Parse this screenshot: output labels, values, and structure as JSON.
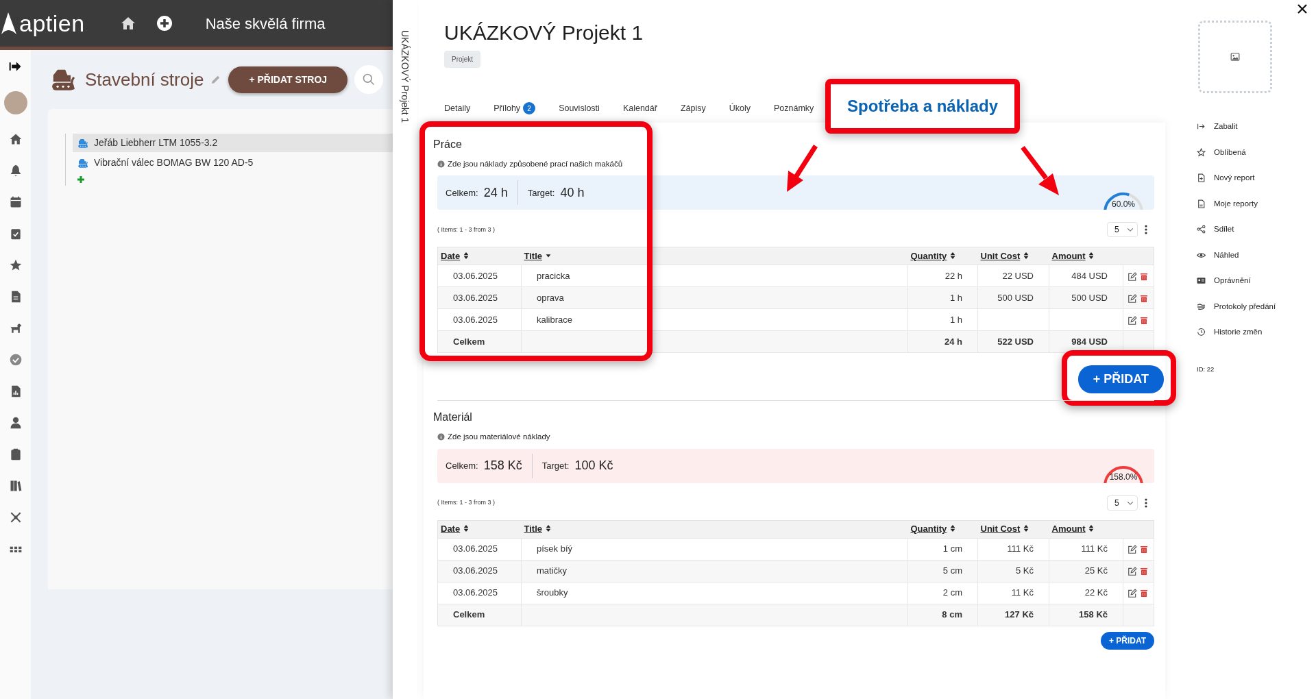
{
  "app": {
    "logo": "aptien",
    "company": "Naše skvělá firma"
  },
  "module": {
    "title": "Stavební stroje",
    "add_button": "+ PŘIDAT STROJ"
  },
  "tree": {
    "items": [
      {
        "label": "Jeřáb Liebherr LTM 1055-3.2",
        "selected": true
      },
      {
        "label": "Vibrační válec BOMAG BW 120 AD-5",
        "selected": false
      }
    ]
  },
  "drawer": {
    "side_title": "UKÁZKOVÝ Projekt 1",
    "title": "UKÁZKOVÝ Projekt 1",
    "badge": "Projekt",
    "tabs": [
      {
        "label": "Detaily",
        "selected": false
      },
      {
        "label": "Přílohy",
        "count": "2",
        "selected": false
      },
      {
        "label": "Souvislosti",
        "selected": false
      },
      {
        "label": "Kalendář",
        "selected": false
      },
      {
        "label": "Zápisy",
        "selected": false
      },
      {
        "label": "Úkoly",
        "selected": false
      },
      {
        "label": "Poznámky",
        "selected": false
      }
    ],
    "callout": "Spotřeba a náklady",
    "sections": [
      {
        "title": "Práce",
        "info": "Zde jsou náklady způsobené prací našich makáčů",
        "color": "#1f7fd6",
        "highlighted": true,
        "total_label": "Celkem:",
        "total": "24 h",
        "target_label": "Target:",
        "target": "40 h",
        "gauge": {
          "level": 0.6,
          "reading": "60.0%"
        },
        "items_info": "( Items: 1 - 3 from 3 )",
        "page_size": "5",
        "columns": [
          {
            "label": "Date",
            "sorted": false
          },
          {
            "label": "Title",
            "sorted": true
          },
          {
            "label": "Quantity",
            "sorted": false
          },
          {
            "label": "Unit Cost",
            "sorted": false
          },
          {
            "label": "Amount",
            "sorted": false
          }
        ],
        "rows": [
          {
            "date": "03.06.2025",
            "title": "pracicka",
            "quantity": "22 h",
            "unit_cost": "22 USD",
            "amount": "484 USD"
          },
          {
            "date": "03.06.2025",
            "title": "oprava",
            "quantity": "1 h",
            "unit_cost": "500 USD",
            "amount": "500 USD"
          },
          {
            "date": "03.06.2025",
            "title": "kalibrace",
            "quantity": "1 h"
          }
        ],
        "footer": {
          "label": "Celkem",
          "quantity": "24 h",
          "unit_cost": "522 USD",
          "amount": "984 USD"
        },
        "add_button": "+ PŘIDAT",
        "add_highlighted": true
      },
      {
        "title": "Materiál",
        "info": "Zde jsou materiálové náklady",
        "color": "#ee3b3b",
        "highlighted": false,
        "total_label": "Celkem:",
        "total": "158 Kč",
        "target_label": "Target:",
        "target": "100 Kč",
        "gauge": {
          "level": 1,
          "reading": "158.0%"
        },
        "items_info": "( Items: 1 - 3 from 3 )",
        "page_size": "5",
        "columns": [
          {
            "label": "Date",
            "sorted": false
          },
          {
            "label": "Title",
            "sorted": false
          },
          {
            "label": "Quantity",
            "sorted": false
          },
          {
            "label": "Unit Cost",
            "sorted": false
          },
          {
            "label": "Amount",
            "sorted": false
          }
        ],
        "rows": [
          {
            "date": "03.06.2025",
            "title": "písek bíý",
            "quantity": "1 cm",
            "unit_cost": "111 Kč",
            "amount": "111 Kč"
          },
          {
            "date": "03.06.2025",
            "title": "matičky",
            "quantity": "5 cm",
            "unit_cost": "5 Kč",
            "amount": "25 Kč"
          },
          {
            "date": "03.06.2025",
            "title": "šroubky",
            "quantity": "2 cm",
            "unit_cost": "11 Kč",
            "amount": "22 Kč"
          }
        ],
        "footer": {
          "label": "Celkem",
          "quantity": "8 cm",
          "unit_cost": "127 Kč",
          "amount": "158 Kč"
        },
        "add_button": "+ PŘIDAT",
        "add_highlighted": false
      }
    ]
  },
  "right_menu": {
    "items": [
      {
        "label": "Zabalit"
      },
      {
        "label": "Oblíbená"
      },
      {
        "label": "Nový report"
      },
      {
        "label": "Moje reporty"
      },
      {
        "label": "Sdílet"
      },
      {
        "label": "Náhled"
      },
      {
        "label": "Oprávnění"
      },
      {
        "label": "Protokoly předání"
      },
      {
        "label": "Historie změn"
      }
    ],
    "id_text": "ID: 22"
  }
}
